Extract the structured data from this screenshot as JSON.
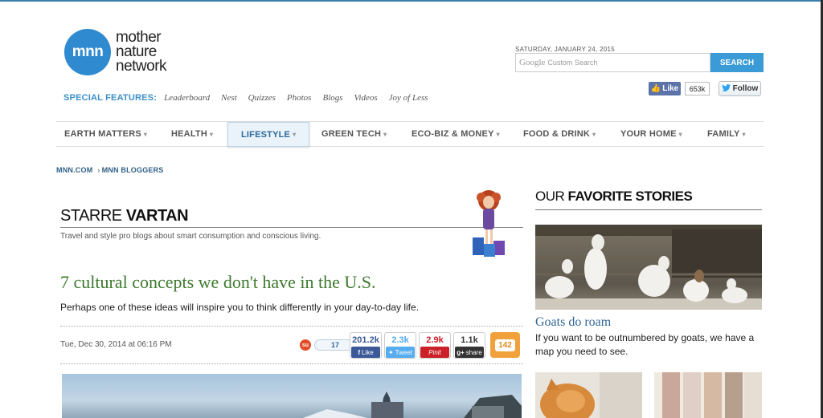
{
  "header": {
    "logo_abbrev": "mnn",
    "logo_lines": [
      "mother",
      "nature",
      "network"
    ],
    "date": "SATURDAY, JANUARY 24, 2015",
    "search_brand": "Google",
    "search_placeholder": "Custom Search",
    "search_button": "SEARCH",
    "fb_like": "Like",
    "fb_count": "653k",
    "twitter_follow": "Follow"
  },
  "special": {
    "label": "SPECIAL FEATURES:",
    "links": [
      "Leaderboard",
      "Nest",
      "Quizzes",
      "Photos",
      "Blogs",
      "Videos",
      "Joy of Less"
    ]
  },
  "nav": {
    "items": [
      "EARTH MATTERS",
      "HEALTH",
      "LIFESTYLE",
      "GREEN TECH",
      "ECO-BIZ & MONEY",
      "FOOD & DRINK",
      "YOUR HOME",
      "FAMILY"
    ],
    "active": "LIFESTYLE"
  },
  "breadcrumb": [
    "MNN.COM",
    "MNN BLOGGERS"
  ],
  "blogger": {
    "first": "STARRE",
    "last": "VARTAN",
    "description": "Travel and style pro blogs about smart consumption and conscious living."
  },
  "article": {
    "headline": "7 cultural concepts we don't have in the U.S.",
    "deck": "Perhaps one of these ideas will inspire you to think differently in your day-to-day life.",
    "date": "Tue, Dec 30, 2014 at 06:16 PM",
    "stumble_count": "17",
    "shares": [
      {
        "count": "201.2k",
        "label": "Like",
        "color": "#3b5998"
      },
      {
        "count": "2.3k",
        "label": "Tweet",
        "color": "#55acee"
      },
      {
        "count": "2.9k",
        "label": "Pinit",
        "color": "#cb2027"
      },
      {
        "count": "1.1k",
        "label": "share",
        "color": "#333333"
      }
    ],
    "comments": "142"
  },
  "sidebar": {
    "title_light": "OUR",
    "title_bold": "FAVORITE STORIES",
    "story_title": "Goats do roam",
    "story_desc": "If you want to be outnumbered by goats, we have a map you need to see."
  },
  "colors": {
    "accent_blue": "#3a9bd7",
    "headline_green": "#3e7a2e",
    "link_blue": "#2e6594"
  }
}
